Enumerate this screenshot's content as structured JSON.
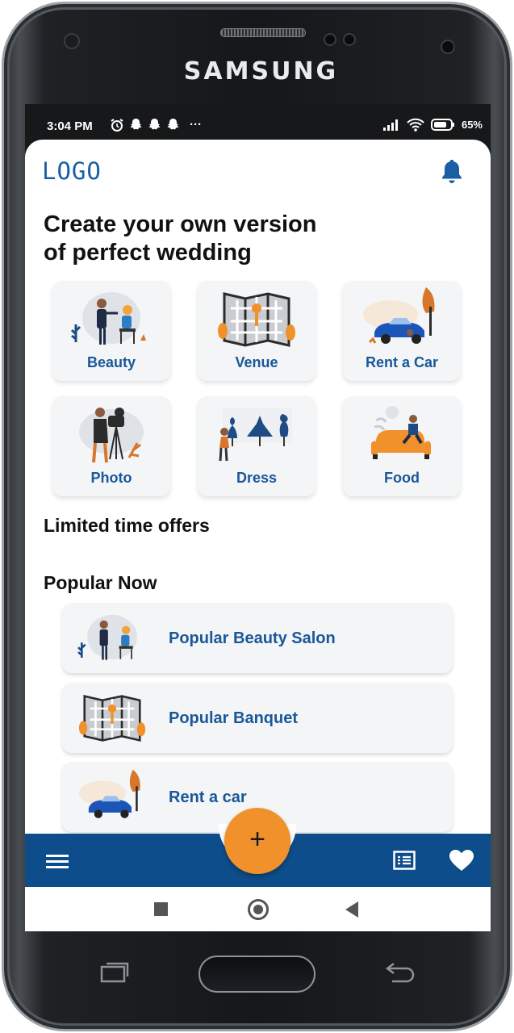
{
  "device": {
    "brand": "SAMSUNG"
  },
  "status_bar": {
    "time": "3:04 PM",
    "extra": "···",
    "battery": "65%"
  },
  "app": {
    "logo": "LOGO",
    "headline_line1": "Create your own version",
    "headline_line2": "of perfect wedding",
    "categories": [
      {
        "label": "Beauty",
        "icon": "beauty-illustration"
      },
      {
        "label": "Venue",
        "icon": "venue-map-illustration"
      },
      {
        "label": "Rent a Car",
        "icon": "car-illustration"
      },
      {
        "label": "Photo",
        "icon": "photo-camera-illustration"
      },
      {
        "label": "Dress",
        "icon": "dress-illustration"
      },
      {
        "label": "Food",
        "icon": "food-sofa-illustration"
      }
    ],
    "limited_offers_title": "Limited time offers",
    "popular_title": "Popular Now",
    "popular_items": [
      {
        "label": "Popular Beauty Salon",
        "icon": "beauty-illustration"
      },
      {
        "label": "Popular Banquet",
        "icon": "venue-map-illustration"
      },
      {
        "label": "Rent a car",
        "icon": "car-illustration"
      }
    ],
    "fab": "+"
  },
  "colors": {
    "primary": "#0e4d8b",
    "accent": "#f0912b",
    "label": "#1a5798",
    "card": "#f3f5f7"
  }
}
